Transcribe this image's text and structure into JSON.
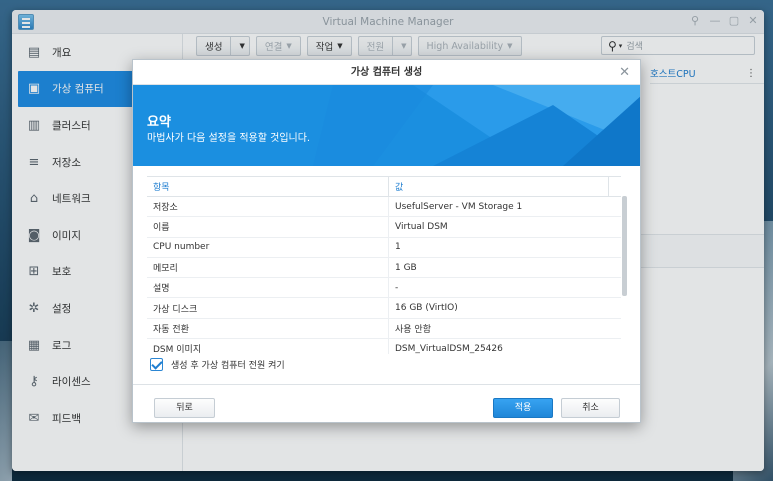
{
  "window": {
    "title": "Virtual Machine Manager"
  },
  "sidebar": {
    "items": [
      {
        "label": "개요",
        "icon": "overview-icon",
        "glyph": "▤"
      },
      {
        "label": "가상 컴퓨터",
        "icon": "virtual-machine-icon",
        "glyph": "▣"
      },
      {
        "label": "클러스터",
        "icon": "cluster-icon",
        "glyph": "▥"
      },
      {
        "label": "저장소",
        "icon": "storage-icon",
        "glyph": "≡"
      },
      {
        "label": "네트워크",
        "icon": "network-icon",
        "glyph": "⌂"
      },
      {
        "label": "이미지",
        "icon": "image-icon",
        "glyph": "◙"
      },
      {
        "label": "보호",
        "icon": "protection-icon",
        "glyph": "⊞"
      },
      {
        "label": "설정",
        "icon": "settings-gear-icon",
        "glyph": "✲"
      },
      {
        "label": "로그",
        "icon": "log-icon",
        "glyph": "▦"
      },
      {
        "label": "라이센스",
        "icon": "license-key-icon",
        "glyph": "⚷"
      },
      {
        "label": "피드백",
        "icon": "feedback-mail-icon",
        "glyph": "✉"
      }
    ],
    "active_index": 1
  },
  "toolbar": {
    "create": "생성",
    "connect": "연결",
    "action": "작업",
    "power": "전원",
    "ha": "High Availability",
    "search_placeholder": "검색"
  },
  "list": {
    "column_host_cpu": "호스트CPU"
  },
  "dialog": {
    "title": "가상 컴퓨터 생성",
    "heading": "요약",
    "subtitle": "마법사가 다음 설정을 적용할 것입니다.",
    "columns": {
      "item": "항목",
      "value": "값"
    },
    "rows": [
      {
        "item": "저장소",
        "value": "UsefulServer - VM Storage 1"
      },
      {
        "item": "이름",
        "value": "Virtual DSM"
      },
      {
        "item": "CPU number",
        "value": "1"
      },
      {
        "item": "메모리",
        "value": "1 GB"
      },
      {
        "item": "설명",
        "value": "-"
      },
      {
        "item": "가상 디스크",
        "value": "16 GB (VirtIO)"
      },
      {
        "item": "자동 전환",
        "value": "사용 안함"
      },
      {
        "item": "DSM 이미지",
        "value": "DSM_VirtualDSM_25426"
      }
    ],
    "power_on_checkbox": {
      "label": "생성 후 가상 컴퓨터 전원 켜기",
      "checked": true
    },
    "back": "뒤로",
    "apply": "적용",
    "cancel": "취소"
  },
  "colors": {
    "accent": "#1e8de5",
    "link": "#1f7ed0"
  }
}
